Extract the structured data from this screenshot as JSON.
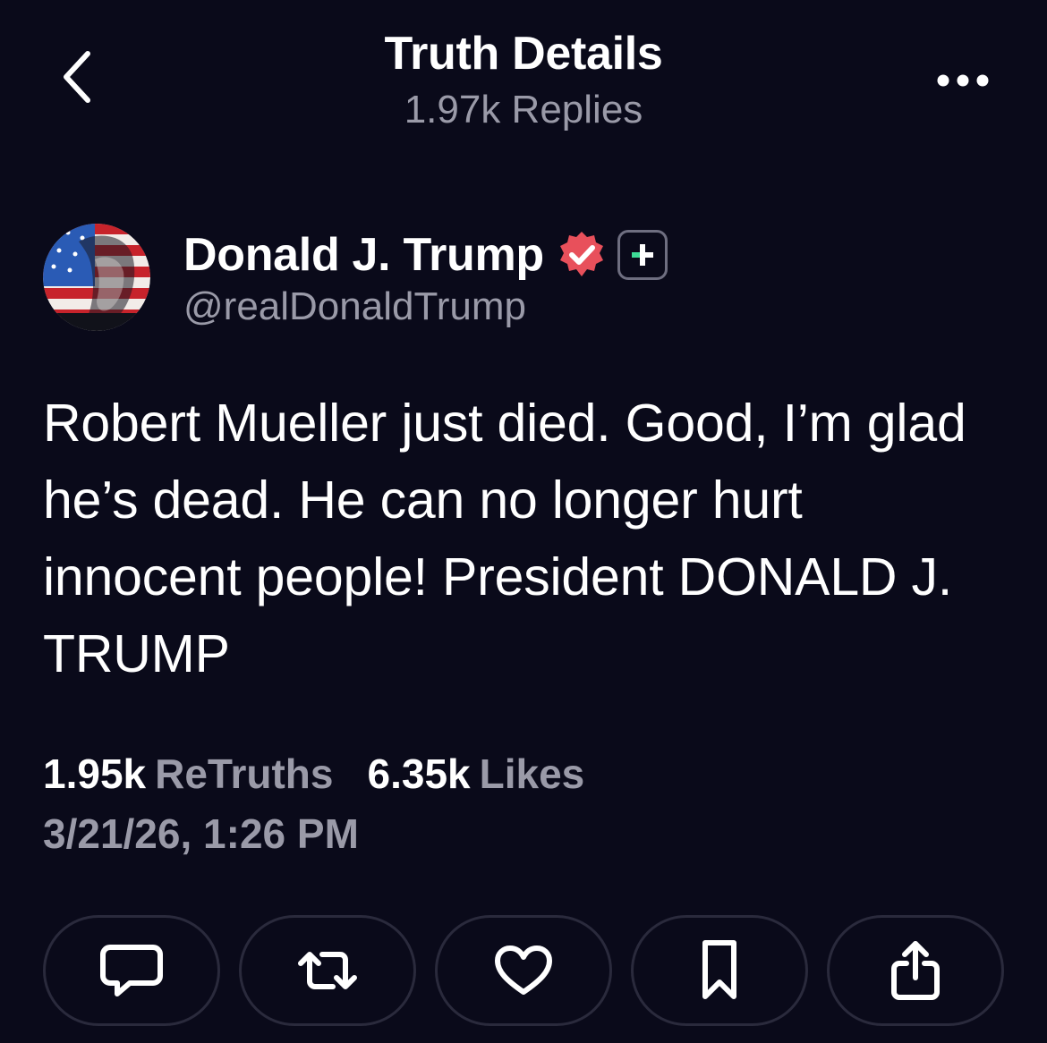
{
  "header": {
    "title": "Truth Details",
    "subtitle": "1.97k Replies",
    "back_icon": "chevron-left-icon",
    "more_icon": "ellipsis-icon"
  },
  "author": {
    "name": "Donald J. Trump",
    "handle": "@realDonaldTrump",
    "verified_badge_color": "#e8505b",
    "plus_badge_color": "#3ddc97"
  },
  "post": {
    "text": "Robert Mueller just died. Good, I’m glad he’s dead. He can no longer hurt innocent people! President DONALD J. TRUMP"
  },
  "stats": {
    "retruths_count": "1.95k",
    "retruths_label": "ReTruths",
    "likes_count": "6.35k",
    "likes_label": "Likes",
    "timestamp": "3/21/26, 1:26 PM"
  },
  "actions": [
    {
      "name": "reply",
      "icon": "comment-icon"
    },
    {
      "name": "retruth",
      "icon": "repost-icon"
    },
    {
      "name": "like",
      "icon": "heart-icon"
    },
    {
      "name": "bookmark",
      "icon": "bookmark-icon"
    },
    {
      "name": "share",
      "icon": "share-icon"
    }
  ],
  "colors": {
    "background": "#0a0a1a",
    "text_primary": "#ffffff",
    "text_secondary": "#9a9aa8",
    "button_border": "#2a2a3c"
  }
}
